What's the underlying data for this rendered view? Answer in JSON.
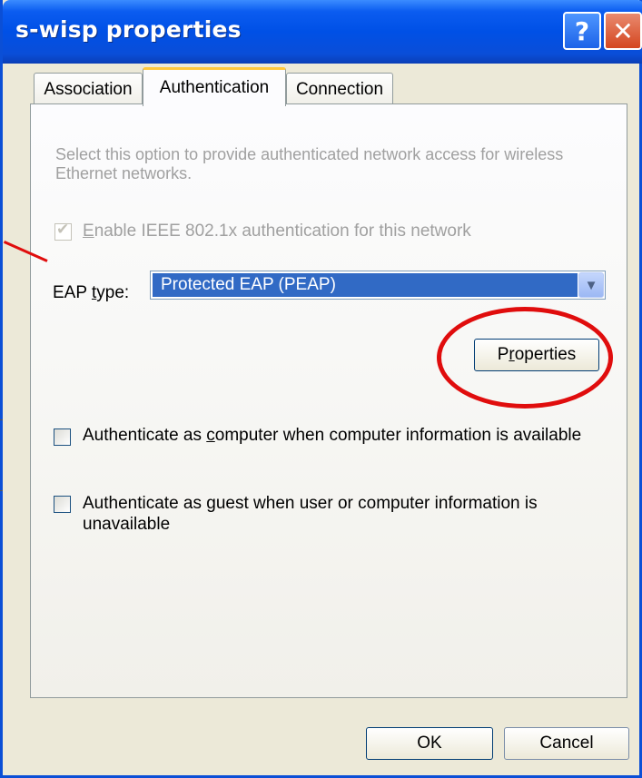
{
  "window": {
    "title": "s-wisp properties"
  },
  "title_buttons": {
    "help": "?",
    "close": "✕"
  },
  "tabs": [
    "Association",
    "Authentication",
    "Connection"
  ],
  "auth": {
    "description": "Select this option to provide authenticated network access for wireless Ethernet networks.",
    "enable_8021x": {
      "pre": "",
      "u": "E",
      "post": "nable IEEE 802.1x authentication for this network",
      "checked": true,
      "enabled": false
    },
    "eap_label": {
      "pre": "EAP ",
      "u": "t",
      "post": "ype:"
    },
    "eap_selected": "Protected EAP (PEAP)",
    "properties_button": {
      "pre": "P",
      "u": "r",
      "post": "operties"
    },
    "auth_computer": {
      "pre": "Authenticate as ",
      "u": "c",
      "post": "omputer when computer information is available",
      "checked": false
    },
    "auth_guest": {
      "pre": "Authenticate as ",
      "u": "g",
      "post": "uest when user or computer information is unavailable",
      "checked": false
    }
  },
  "footer": {
    "ok": "OK",
    "cancel": "Cancel"
  },
  "annotation_color": "#e00d0d"
}
